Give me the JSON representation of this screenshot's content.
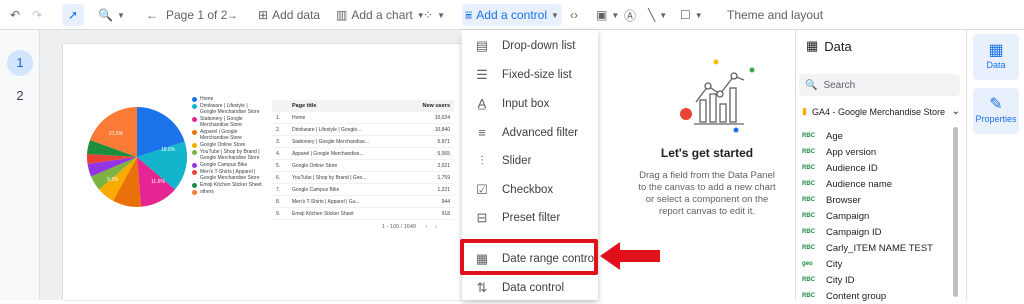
{
  "toolbar": {
    "page_nav": "Page 1 of 2",
    "add_data": "Add data",
    "add_chart": "Add a chart",
    "add_control": "Add a control",
    "theme_layout": "Theme and layout"
  },
  "pages": [
    "1",
    "2"
  ],
  "report": {
    "pie": {
      "slice_labels": [
        "21.6%",
        "18.6%",
        "11.6%",
        "9.3%"
      ],
      "legend": [
        "Home",
        "Drinkware | Lifestyle | Google Merchandise Store",
        "Stationery | Google Merchandise Store",
        "Apparel | Google Merchandise Store",
        "Google Online Store",
        "YouTube | Shop by Brand | Google Merchandise Store",
        "Google Campus Bike",
        "Men's T-Shirts | Apparel | Google Merchandise Store",
        "Emoji Kitchen Sticker Sheet",
        "others"
      ]
    },
    "table": {
      "headers": [
        "Page title",
        "New users"
      ],
      "rows": [
        [
          "1.",
          "Home",
          "10,024"
        ],
        [
          "2.",
          "Drinkware | Lifestyle | Google...",
          "10,840"
        ],
        [
          "3.",
          "Stationery | Google Merchandise...",
          "5,971"
        ],
        [
          "4.",
          "Apparel | Google Merchandise...",
          "5,065"
        ],
        [
          "5.",
          "Google Online Store",
          "2,021"
        ],
        [
          "6.",
          "YouTube | Shop by Brand | Goo...",
          "1,759"
        ],
        [
          "7.",
          "Google Campus Bike",
          "1,221"
        ],
        [
          "8.",
          "Men's T-Shirts | Apparel | Gu...",
          "944"
        ],
        [
          "9.",
          "Emoji Kitchen Sticker Sheet",
          "918"
        ]
      ],
      "pagination": "1 - 100 / 1649"
    }
  },
  "control_menu": {
    "items": [
      "Drop-down list",
      "Fixed-size list",
      "Input box",
      "Advanced filter",
      "Slider",
      "Checkbox",
      "Preset filter",
      "Date range control",
      "Data control"
    ]
  },
  "empty_state": {
    "title": "Let's get started",
    "body": "Drag a field from the Data Panel to the canvas to add a new chart or select a component on the report canvas to edit it."
  },
  "data_panel": {
    "title": "Data",
    "search_placeholder": "Search",
    "source": "GA4 - Google Merchandise Store",
    "fields": [
      {
        "type": "RBC",
        "name": "Age"
      },
      {
        "type": "RBC",
        "name": "App version"
      },
      {
        "type": "RBC",
        "name": "Audience ID"
      },
      {
        "type": "RBC",
        "name": "Audience name"
      },
      {
        "type": "RBC",
        "name": "Browser"
      },
      {
        "type": "RBC",
        "name": "Campaign"
      },
      {
        "type": "RBC",
        "name": "Campaign ID"
      },
      {
        "type": "RBC",
        "name": "Carly_ITEM NAME TEST"
      },
      {
        "type": "geo",
        "name": "City"
      },
      {
        "type": "RBC",
        "name": "City ID"
      },
      {
        "type": "RBC",
        "name": "Content group"
      }
    ]
  },
  "right_rail": {
    "data": "Data",
    "properties": "Properties"
  },
  "colors": {
    "accent": "#1a73e8",
    "highlight": "#e0111a"
  }
}
